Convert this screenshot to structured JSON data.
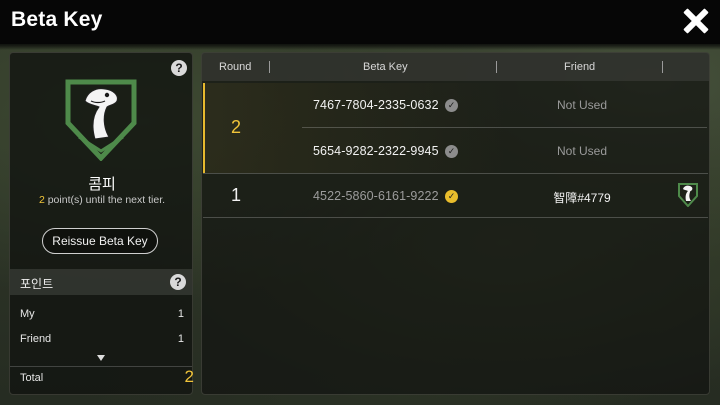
{
  "window": {
    "title": "Beta Key"
  },
  "left_panel": {
    "tier_name": "콤피",
    "points_needed": "2",
    "points_suffix": " point(s) until the next tier.",
    "reissue_button": "Reissue Beta Key",
    "points_section": {
      "label": "포인트",
      "rows": [
        {
          "label": "My",
          "value": "1"
        },
        {
          "label": "Friend",
          "value": "1"
        }
      ],
      "total_label": "Total",
      "total_value": "2"
    }
  },
  "table": {
    "headers": {
      "round": "Round",
      "key": "Beta Key",
      "friend": "Friend"
    },
    "groups": [
      {
        "round": "2",
        "rows": [
          {
            "key": "7467-7804-2335-0632",
            "friend": "Not Used",
            "used": false
          },
          {
            "key": "5654-9282-2322-9945",
            "friend": "Not Used",
            "used": false
          }
        ]
      },
      {
        "round": "1",
        "rows": [
          {
            "key": "4522-5860-6161-9222",
            "friend": "智障#4779",
            "used": true
          }
        ]
      }
    ]
  },
  "colors": {
    "accent_gold": "#f0c43a",
    "emblem_green": "#4e8a4a"
  },
  "icons": [
    "close-icon",
    "help-icon",
    "dinosaur-emblem-icon",
    "check-icon",
    "chevron-down-icon"
  ]
}
